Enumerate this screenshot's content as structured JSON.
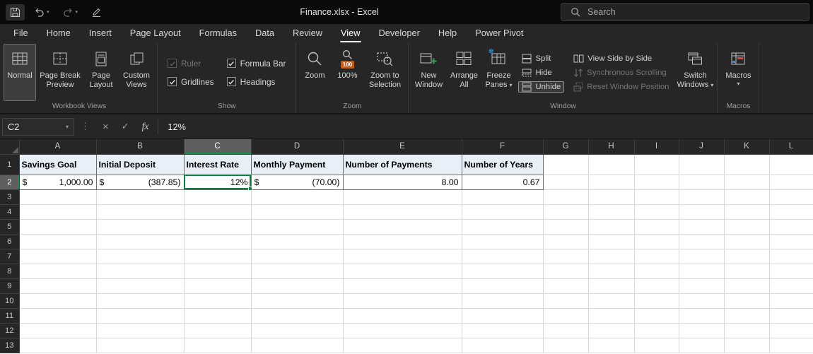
{
  "icons": {
    "chevron_down": "▾",
    "dots_separator": "⋮",
    "cancel": "×",
    "enter": "✓",
    "fx": "fx",
    "snowflake": "❄",
    "hundred": "100"
  },
  "title_bar": {
    "title": "Finance.xlsx  -  Excel",
    "search_placeholder": "Search"
  },
  "tabs": {
    "items": [
      "File",
      "Home",
      "Insert",
      "Page Layout",
      "Formulas",
      "Data",
      "Review",
      "View",
      "Developer",
      "Help",
      "Power Pivot"
    ],
    "active": "View"
  },
  "ribbon": {
    "workbook_views": {
      "group_label": "Workbook Views",
      "normal": "Normal",
      "page_break_preview": "Page Break Preview",
      "page_layout": "Page Layout",
      "custom_views": "Custom Views"
    },
    "show": {
      "group_label": "Show",
      "ruler": "Ruler",
      "gridlines": "Gridlines",
      "formula_bar": "Formula Bar",
      "headings": "Headings"
    },
    "zoom": {
      "group_label": "Zoom",
      "zoom": "Zoom",
      "hundred_percent": "100%",
      "zoom_to_selection": "Zoom to Selection"
    },
    "window": {
      "group_label": "Window",
      "new_window": "New Window",
      "arrange_all": "Arrange All",
      "freeze_panes": "Freeze Panes",
      "split": "Split",
      "hide": "Hide",
      "unhide": "Unhide",
      "view_side_by_side": "View Side by Side",
      "synchronous_scrolling": "Synchronous Scrolling",
      "reset_window_position": "Reset Window Position",
      "switch_windows": "Switch Windows"
    },
    "macros": {
      "group_label": "Macros",
      "macros": "Macros"
    }
  },
  "formula_bar": {
    "name_box": "C2",
    "formula": "12%"
  },
  "sheet": {
    "columns": [
      "A",
      "B",
      "C",
      "D",
      "E",
      "F",
      "G",
      "H",
      "I",
      "J",
      "K",
      "L"
    ],
    "rows": [
      "1",
      "2",
      "3",
      "4",
      "5",
      "6",
      "7",
      "8",
      "9",
      "10",
      "11",
      "12",
      "13"
    ],
    "selected_column": "C",
    "selected_cell": "C2",
    "header_row": {
      "savings_goal": "Savings Goal",
      "initial_deposit": "Initial Deposit",
      "interest_rate": "Interest Rate",
      "monthly_payment": "Monthly Payment",
      "number_of_payments": "Number of Payments",
      "number_of_years": "Number of Years"
    },
    "values": {
      "savings_goal_symbol": "$",
      "savings_goal": "1,000.00",
      "initial_deposit_symbol": "$",
      "initial_deposit": "(387.85)",
      "interest_rate": "12%",
      "monthly_payment_symbol": "$",
      "monthly_payment": "(70.00)",
      "number_of_payments": "8.00",
      "number_of_years": "0.67"
    }
  },
  "colors": {
    "selection_green": "#107C41",
    "header_fill": "#E9EFF7",
    "badge_orange": "#C55A11"
  }
}
